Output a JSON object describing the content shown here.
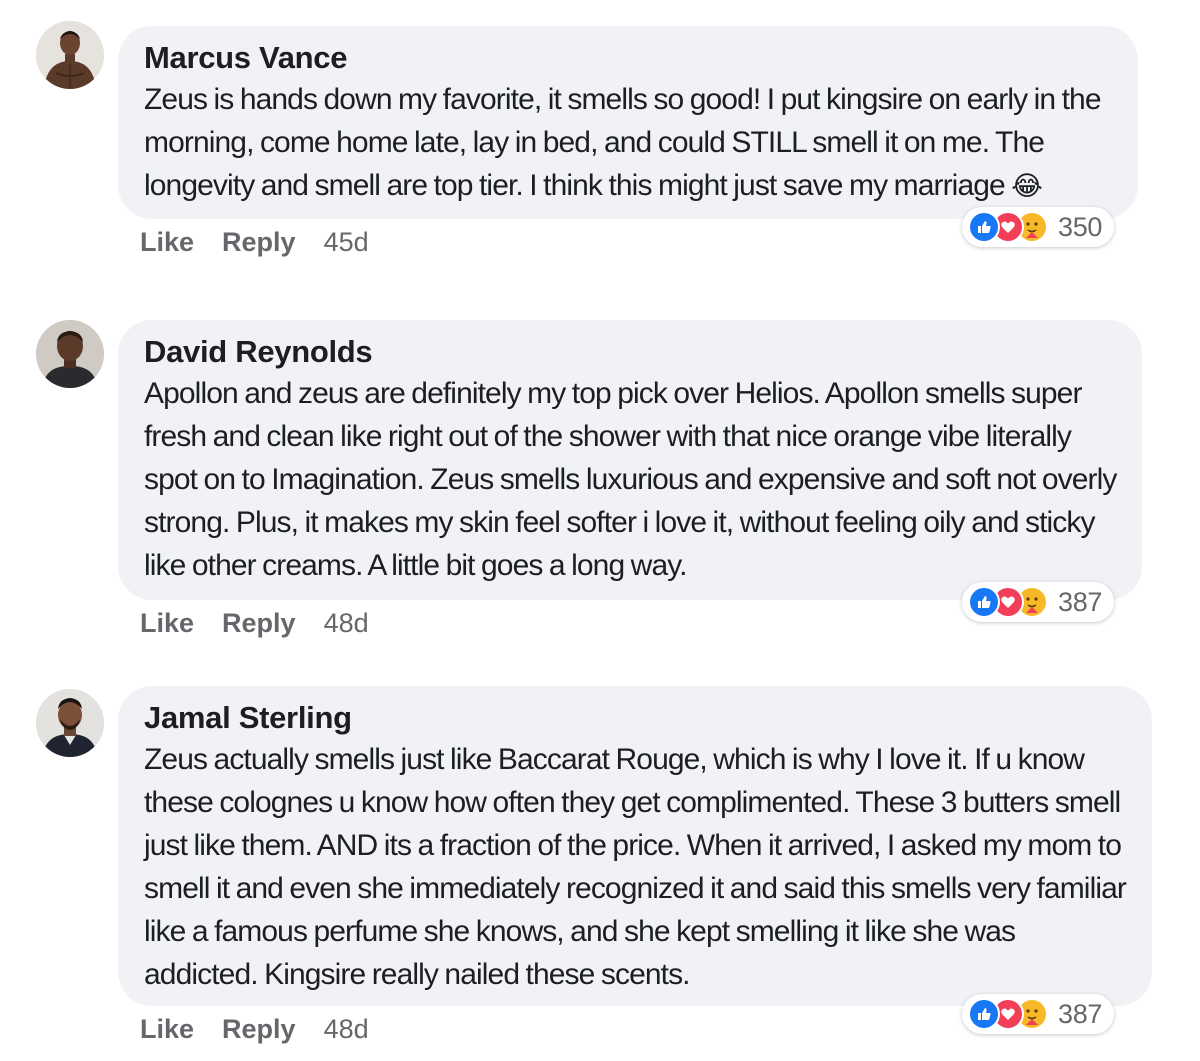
{
  "comments": [
    {
      "author": "Marcus Vance",
      "text": "Zeus is hands down my favorite, it smells so good! I put kingsire on early in the morning, come home late, lay in bed, and could STILL smell it on me. The longevity and smell are top tier. I think this might just save my marriage",
      "emoji": "😂",
      "reaction_count": "350",
      "like_label": "Like",
      "reply_label": "Reply",
      "age": "45d"
    },
    {
      "author": "David Reynolds",
      "text": "Apollon and zeus are definitely my top pick over Helios. Apollon smells super fresh and clean like right out of the shower with that nice orange vibe literally spot on to Imagination. Zeus smells luxurious and expensive and soft not overly strong. Plus, it makes my skin feel softer i love it, without feeling oily and sticky like other creams. A little bit goes a long way.",
      "reaction_count": "387",
      "like_label": "Like",
      "reply_label": "Reply",
      "age": "48d"
    },
    {
      "author": "Jamal Sterling",
      "text": "Zeus actually smells just like Baccarat Rouge, which is why I love it. If u know these colognes u know how often they get complimented. These 3 butters smell just like them. AND its a fraction of the price. When it arrived, I asked my mom to smell it and even she immediately recognized it and said this smells very familiar like a famous perfume she knows, and she kept smelling it like she was addicted. Kingsire really nailed these scents.",
      "reaction_count": "387",
      "like_label": "Like",
      "reply_label": "Reply",
      "age": "48d"
    }
  ],
  "colors": {
    "bubble": "#f0f2f5",
    "muted": "#65676b",
    "like": "#1877f2",
    "love": "#f33e58",
    "care": "#f7b928"
  },
  "icons": [
    "like-reaction-icon",
    "love-reaction-icon",
    "care-reaction-icon",
    "laughing-emoji-icon"
  ]
}
